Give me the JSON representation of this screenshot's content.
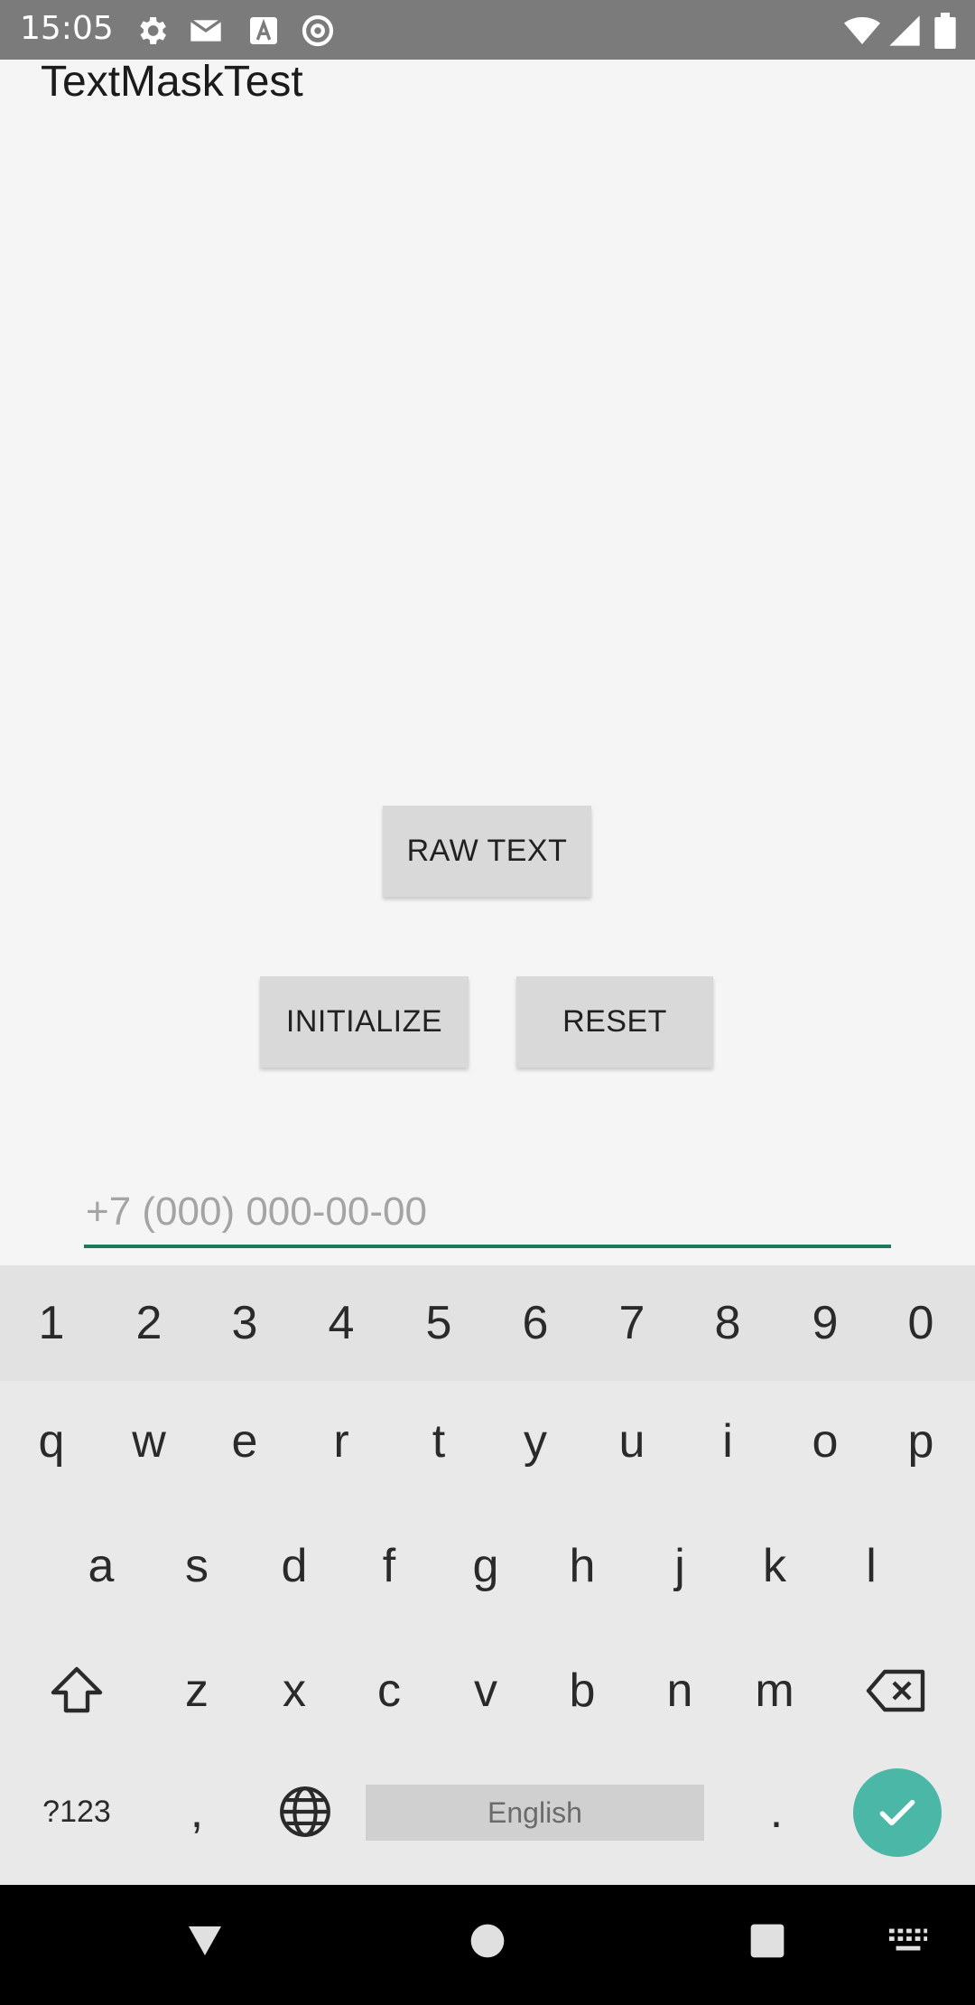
{
  "status_bar": {
    "time": "15:05",
    "icons": [
      "gear-icon",
      "mail-icon",
      "a-icon",
      "at-icon",
      "wifi-icon",
      "signal-icon",
      "battery-icon"
    ]
  },
  "app": {
    "title": "TextMaskTest"
  },
  "buttons": {
    "raw_text": "RAW TEXT",
    "initialize": "INITIALIZE",
    "reset": "RESET"
  },
  "input": {
    "placeholder": "+7 (000) 000-00-00",
    "value": ""
  },
  "keyboard": {
    "numbers": [
      "1",
      "2",
      "3",
      "4",
      "5",
      "6",
      "7",
      "8",
      "9",
      "0"
    ],
    "row1": [
      "q",
      "w",
      "e",
      "r",
      "t",
      "y",
      "u",
      "i",
      "o",
      "p"
    ],
    "row2": [
      "a",
      "s",
      "d",
      "f",
      "g",
      "h",
      "j",
      "k",
      "l"
    ],
    "row3": [
      "z",
      "x",
      "c",
      "v",
      "b",
      "n",
      "m"
    ],
    "symbols_label": "?123",
    "comma": ",",
    "space_label": "English",
    "period": ".",
    "accent_color": "#4bb7a6"
  },
  "colors": {
    "status_bar": "#7b7b7b",
    "input_underline": "#1b7a5c",
    "button_bg": "#d9d9d9"
  }
}
